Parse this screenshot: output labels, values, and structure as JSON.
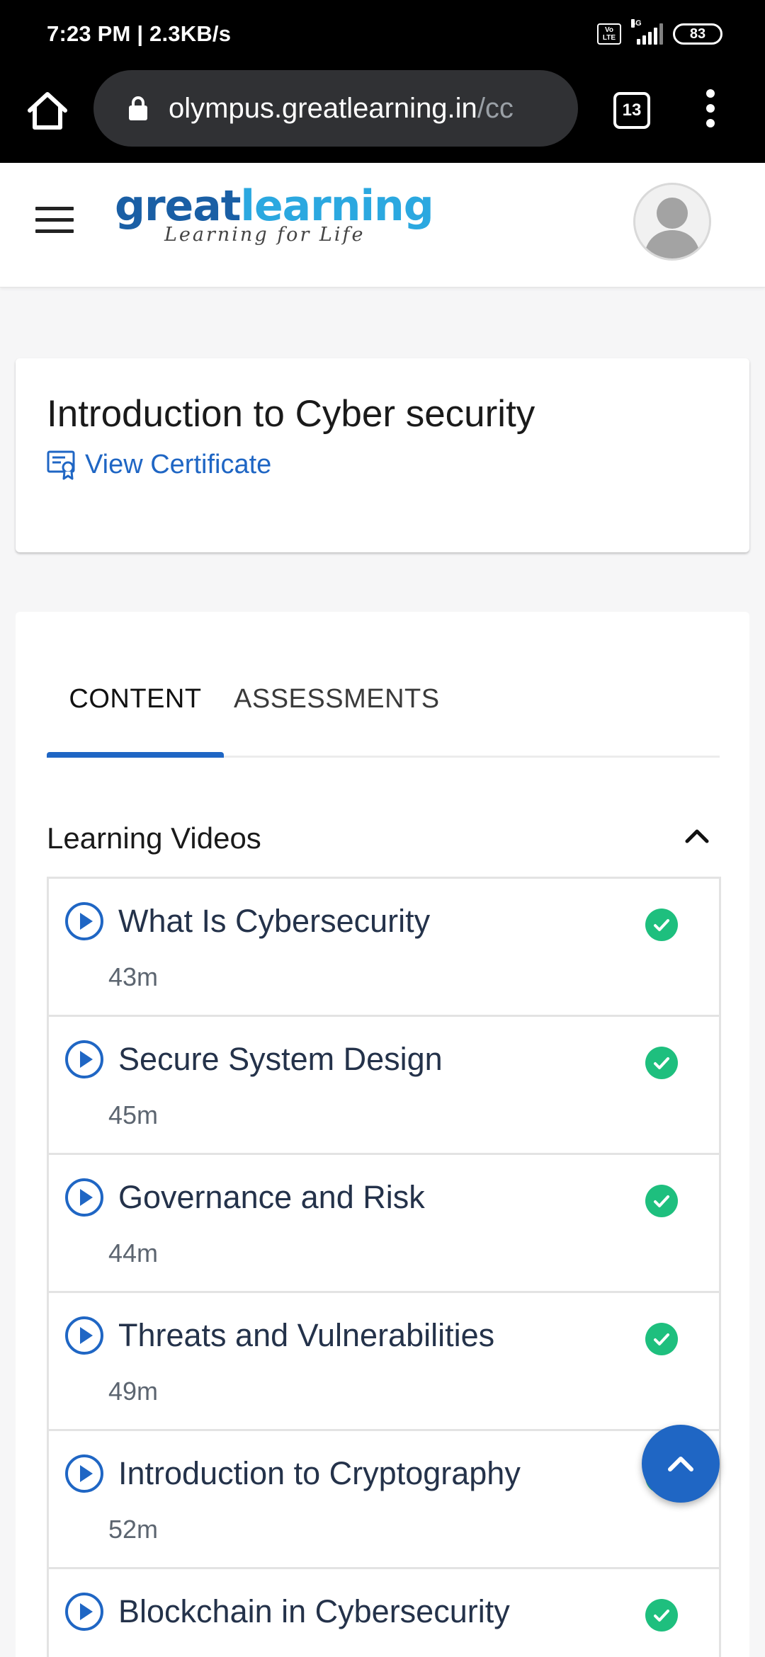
{
  "status_bar": {
    "time": "7:23 PM | 2.3KB/s",
    "volte_label": "Vo LTE",
    "network_label": "4G",
    "battery": "83"
  },
  "browser": {
    "url_main": "olympus.greatlearning.in",
    "url_faded": "/cc",
    "tab_count": "13"
  },
  "header": {
    "logo_part1": "great",
    "logo_part2": "learning",
    "logo_tagline": "Learning for Life"
  },
  "course": {
    "title": "Introduction to Cyber security",
    "certificate_link": "View Certificate"
  },
  "tabs": {
    "content": "CONTENT",
    "assessments": "ASSESSMENTS"
  },
  "section": {
    "title": "Learning Videos"
  },
  "videos": [
    {
      "title": "What Is Cybersecurity",
      "duration": "43m",
      "completed": true
    },
    {
      "title": "Secure System Design",
      "duration": "45m",
      "completed": true
    },
    {
      "title": "Governance and Risk",
      "duration": "44m",
      "completed": true
    },
    {
      "title": "Threats and Vulnerabilities",
      "duration": "49m",
      "completed": true
    },
    {
      "title": "Introduction to Cryptography",
      "duration": "52m",
      "completed": true
    },
    {
      "title": "Blockchain in Cybersecurity",
      "duration": "",
      "completed": true
    }
  ],
  "colors": {
    "accent_blue": "#1f66c4",
    "check_green": "#1ebf7e",
    "logo_dark_blue": "#1a5fa5",
    "logo_light_blue": "#2ba8e0"
  },
  "icons": {
    "home": "home-icon",
    "lock": "lock-icon",
    "menu": "hamburger-icon",
    "certificate": "certificate-icon",
    "collapse": "chevron-up-icon",
    "play": "play-circle-icon",
    "complete": "check-circle-icon",
    "scroll_top": "chevron-up-icon"
  }
}
